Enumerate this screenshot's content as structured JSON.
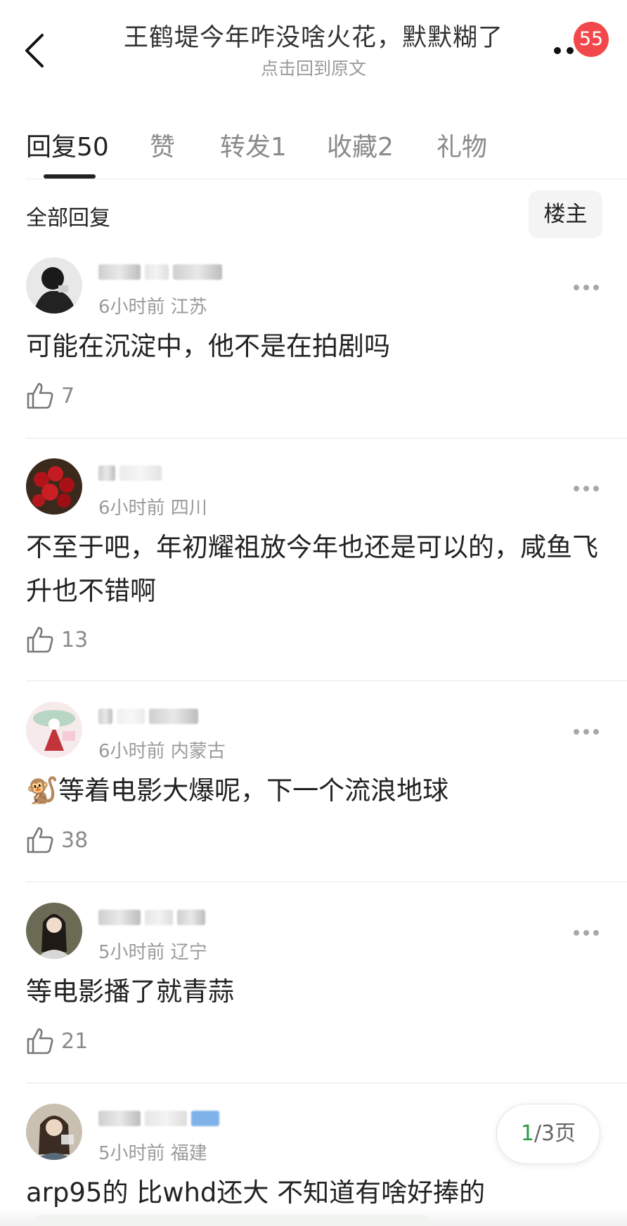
{
  "header": {
    "title": "王鹤堤今年咋没啥火花，默默糊了",
    "subtitle": "点击回到原文",
    "badge": "55"
  },
  "tabs": [
    {
      "label": "回复",
      "count": "50"
    },
    {
      "label": "赞",
      "count": ""
    },
    {
      "label": "转发",
      "count": "1"
    },
    {
      "label": "收藏",
      "count": "2"
    },
    {
      "label": "礼物",
      "count": ""
    }
  ],
  "filter": {
    "label": "全部回复",
    "owner_button": "楼主"
  },
  "comments": [
    {
      "meta": "6小时前 江苏",
      "text": "可能在沉淀中，他不是在拍剧吗",
      "likes": "7"
    },
    {
      "meta": "6小时前 四川",
      "text": "不至于吧，年初耀祖放今年也还是可以的，咸鱼飞升也不错啊",
      "likes": "13"
    },
    {
      "meta": "6小时前 内蒙古",
      "text": "🐒等着电影大爆呢，下一个流浪地球",
      "likes": "38"
    },
    {
      "meta": "5小时前 辽宁",
      "text": "等电影播了就青蒜",
      "likes": "21"
    },
    {
      "meta": "5小时前 福建",
      "text": "arp95的 比whd还大 不知道有啥好捧的",
      "likes": ""
    }
  ],
  "pagination": {
    "current": "1",
    "rest": "/3页"
  },
  "colors": {
    "badge": "#f2484b",
    "page_current": "#2a9a48",
    "divider": "#e6e6e6"
  }
}
